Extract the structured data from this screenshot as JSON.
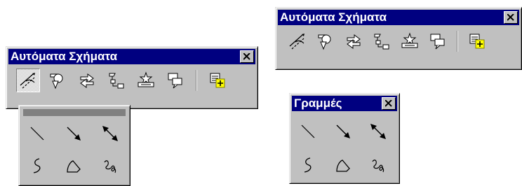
{
  "autoshapes_toolbar": {
    "title": "Αυτόματα Σχήματα",
    "buttons": [
      {
        "icon": "lines-icon"
      },
      {
        "icon": "basic-shapes-icon"
      },
      {
        "icon": "block-arrows-icon"
      },
      {
        "icon": "flowchart-icon"
      },
      {
        "icon": "stars-banners-icon"
      },
      {
        "icon": "callouts-icon"
      },
      {
        "icon": "more-autoshapes-icon"
      }
    ]
  },
  "lines_menu": {
    "items": [
      {
        "icon": "line-icon"
      },
      {
        "icon": "arrow-icon"
      },
      {
        "icon": "double-arrow-icon"
      },
      {
        "icon": "curve-icon"
      },
      {
        "icon": "freeform-icon"
      },
      {
        "icon": "scribble-icon"
      }
    ]
  },
  "lines_toolbar": {
    "title": "Γραμμές"
  },
  "colors": {
    "titlebar": "#000080",
    "face": "#c0c0c0"
  }
}
